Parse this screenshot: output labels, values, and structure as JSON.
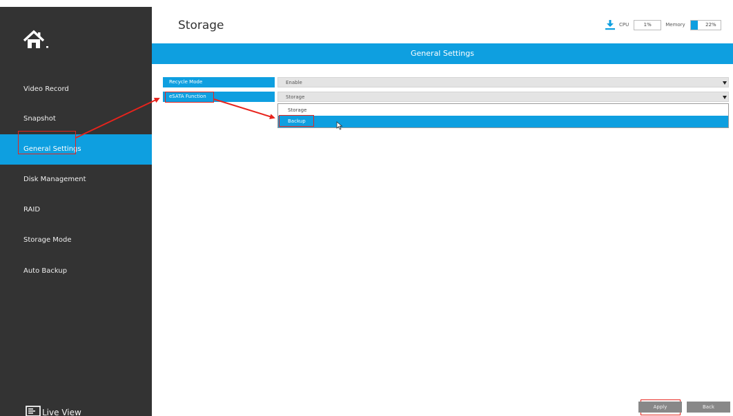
{
  "header": {
    "title": "Storage",
    "cpu_label": "CPU",
    "cpu_value": "1%",
    "memory_label": "Memory",
    "memory_value": "22%",
    "memory_fraction": 0.22
  },
  "sidebar": {
    "items": [
      {
        "label": "Video Record"
      },
      {
        "label": "Snapshot"
      },
      {
        "label": "General Settings",
        "active": true
      },
      {
        "label": "Disk Management"
      },
      {
        "label": "RAID"
      },
      {
        "label": "Storage Mode"
      },
      {
        "label": "Auto Backup"
      }
    ],
    "live_view_label": "Live View"
  },
  "banner": {
    "title": "General Settings"
  },
  "form": {
    "recycle_mode": {
      "label": "Recycle Mode",
      "value": "Enable"
    },
    "esata_function": {
      "label": "eSATA Function",
      "value": "Storage",
      "options": [
        "Storage",
        "Backup"
      ],
      "highlighted_option": "Backup"
    }
  },
  "buttons": {
    "apply": "Apply",
    "back": "Back"
  },
  "colors": {
    "accent": "#0e9fe0",
    "sidebar": "#333333",
    "annotation": "#e8231c",
    "button": "#888888"
  },
  "icons": [
    "home-icon",
    "download-icon",
    "monitor-icon",
    "mouse-cursor-icon",
    "dropdown-arrow-icon"
  ]
}
